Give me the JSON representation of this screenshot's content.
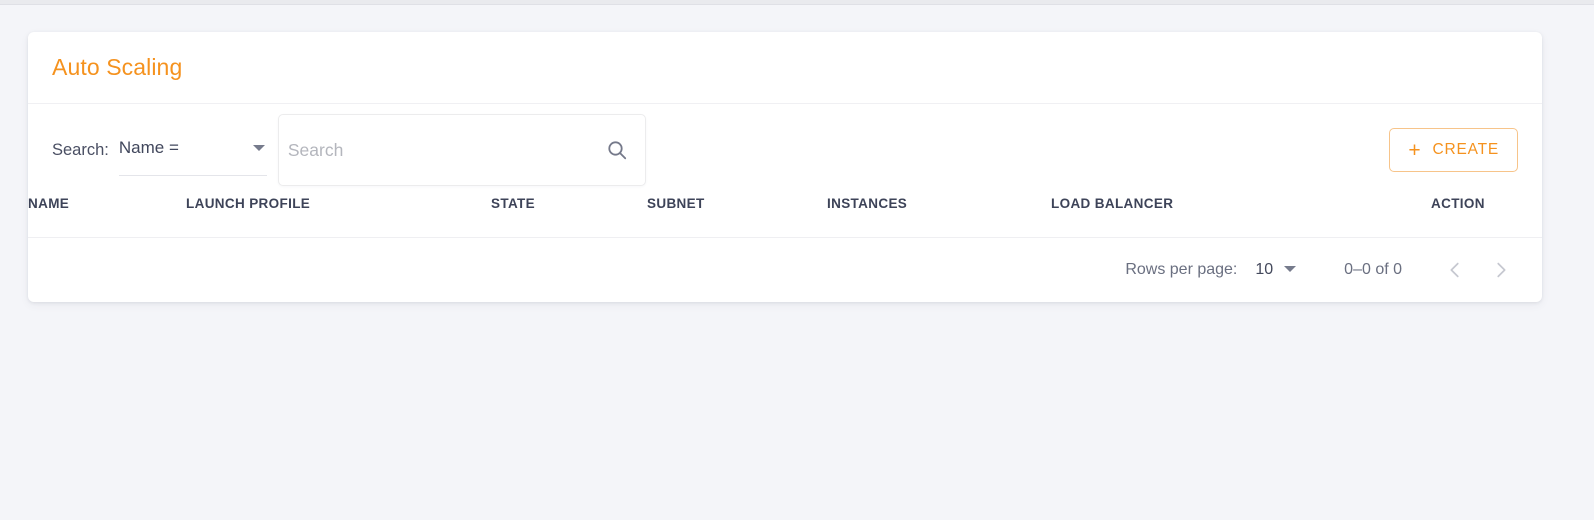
{
  "theme": {
    "accent": "#f5921e",
    "page_background": "#f4f5f9",
    "card_background": "#ffffff",
    "header_text": "#3d4358",
    "muted_text": "#6a6f80"
  },
  "card": {
    "title": "Auto Scaling"
  },
  "toolbar": {
    "search_label": "Search:",
    "field_select": {
      "value": "Name =",
      "icon": "chevron-down-icon"
    },
    "search": {
      "value": "",
      "placeholder": "Search",
      "icon": "search-icon"
    },
    "create_button": {
      "label": "CREATE",
      "icon": "plus-icon"
    }
  },
  "table": {
    "columns": [
      {
        "key": "name",
        "label": "NAME"
      },
      {
        "key": "launch_profile",
        "label": "LAUNCH PROFILE"
      },
      {
        "key": "state",
        "label": "STATE"
      },
      {
        "key": "subnet",
        "label": "SUBNET"
      },
      {
        "key": "instances",
        "label": "INSTANCES"
      },
      {
        "key": "load_balancer",
        "label": "LOAD BALANCER"
      },
      {
        "key": "action",
        "label": "ACTION"
      }
    ],
    "rows": []
  },
  "pagination": {
    "rows_per_page_label": "Rows per page:",
    "rows_per_page_value": "10",
    "rows_per_page_icon": "chevron-down-icon",
    "range_label": "0–0 of 0",
    "previous_icon": "chevron-left-icon",
    "next_icon": "chevron-right-icon"
  }
}
